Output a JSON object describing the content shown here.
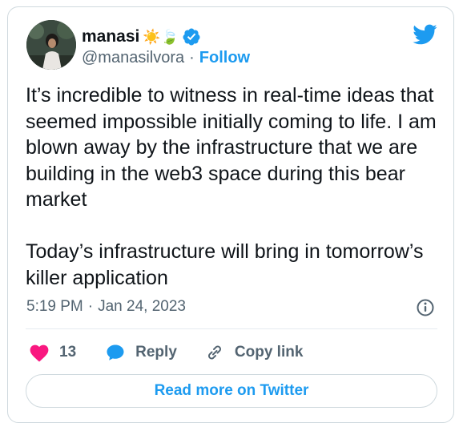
{
  "tweet": {
    "author_name": "manasi",
    "name_emojis": "☀️🍃",
    "handle": "@manasilvora",
    "separator": "·",
    "follow_label": "Follow",
    "text": "It’s incredible to witness in real-time ideas that seemed impossible initially coming to life. I am blown away by the infrastructure that we are building in the web3 space during this bear market\n\nToday’s infrastructure will bring in tomorrow’s killer application",
    "time": "5:19 PM",
    "date": "Jan 24, 2023"
  },
  "actions": {
    "like_count": "13",
    "reply_label": "Reply",
    "copy_link_label": "Copy link"
  },
  "footer": {
    "read_more_label": "Read more on Twitter"
  },
  "colors": {
    "accent": "#1d9bf0",
    "like": "#f91880",
    "secondary_text": "#536471",
    "border": "#cfd9de"
  },
  "icons": [
    "verified-badge-icon",
    "twitter-bird-icon",
    "info-icon",
    "heart-icon",
    "reply-bubble-icon",
    "link-icon"
  ]
}
